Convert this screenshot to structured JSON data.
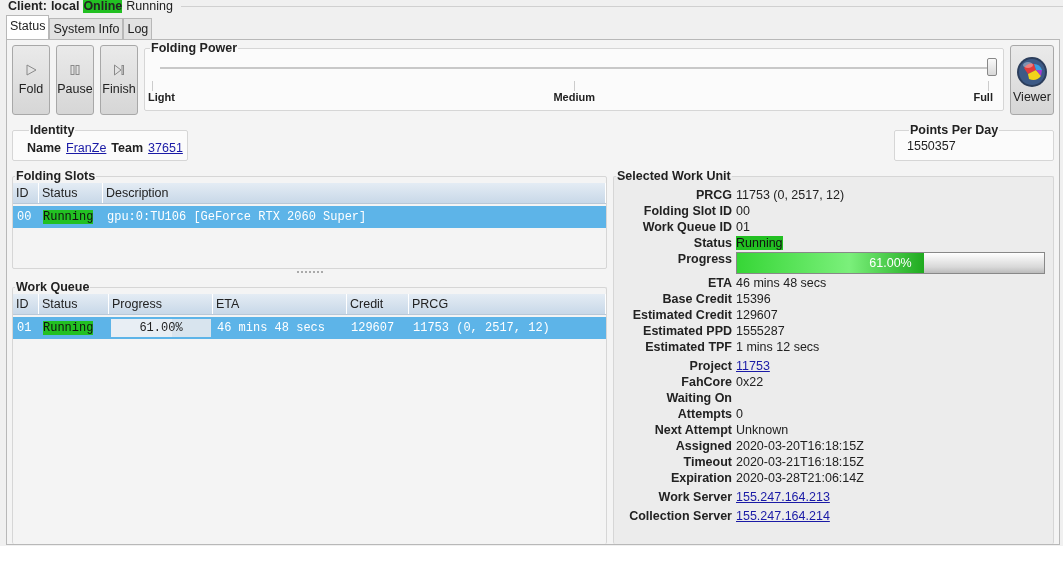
{
  "client": {
    "label": "Client:",
    "name": "local",
    "state": "Online",
    "status": "Running"
  },
  "tabs": [
    {
      "label": "Status",
      "selected": true
    },
    {
      "label": "System Info",
      "selected": false
    },
    {
      "label": "Log",
      "selected": false
    }
  ],
  "controls": [
    {
      "label": "Fold",
      "kind": "play"
    },
    {
      "label": "Pause",
      "kind": "pause"
    },
    {
      "label": "Finish",
      "kind": "finish"
    }
  ],
  "folding_power": {
    "title": "Folding Power",
    "level": 1,
    "ticks": [
      "Light",
      "Medium",
      "Full"
    ]
  },
  "viewer_button": {
    "label": "Viewer"
  },
  "identity": {
    "title": "Identity",
    "name_label": "Name",
    "name": "FranZe",
    "team_label": "Team",
    "team": "37651"
  },
  "points_per_day": {
    "title": "Points Per Day",
    "value": "1550357"
  },
  "folding_slots": {
    "title": "Folding Slots",
    "columns": [
      "ID",
      "Status",
      "Description"
    ],
    "rows": [
      {
        "id": "00",
        "status": "Running",
        "description": "gpu:0:TU106 [GeForce RTX 2060 Super]",
        "selected": true
      }
    ]
  },
  "work_queue": {
    "title": "Work Queue",
    "columns": [
      "ID",
      "Status",
      "Progress",
      "ETA",
      "Credit",
      "PRCG"
    ],
    "rows": [
      {
        "id": "01",
        "status": "Running",
        "progress": {
          "text": "61.00%",
          "level": 0.61
        },
        "eta": "46 mins 48 secs",
        "credit": "129607",
        "prcg": "11753 (0, 2517, 12)",
        "selected": true
      }
    ]
  },
  "selected_work_unit": {
    "title": "Selected Work Unit",
    "fields": [
      {
        "label": "PRCG",
        "value": "11753 (0, 2517, 12)",
        "kind": "text"
      },
      {
        "label": "Folding Slot ID",
        "value": "00",
        "kind": "text"
      },
      {
        "label": "Work Queue ID",
        "value": "01",
        "kind": "text"
      },
      {
        "label": "Status",
        "value": "Running",
        "kind": "status"
      },
      {
        "label": "Progress",
        "value": "61.00%",
        "level": 0.61,
        "kind": "progress"
      },
      {
        "label": "ETA",
        "value": "46 mins 48 secs",
        "kind": "text"
      },
      {
        "label": "Base Credit",
        "value": "15396",
        "kind": "text"
      },
      {
        "label": "Estimated Credit",
        "value": "129607",
        "kind": "text"
      },
      {
        "label": "Estimated PPD",
        "value": "1555287",
        "kind": "text"
      },
      {
        "label": "Estimated TPF",
        "value": "1 mins 12 secs",
        "kind": "text"
      },
      {
        "label": "Project",
        "value": "11753",
        "kind": "link"
      },
      {
        "label": "FahCore",
        "value": "0x22",
        "kind": "text"
      },
      {
        "label": "Waiting On",
        "kind": "text"
      },
      {
        "label": "Attempts",
        "value": "0",
        "kind": "text"
      },
      {
        "label": "Next Attempt",
        "value": "Unknown",
        "kind": "text"
      },
      {
        "label": "Assigned",
        "value": "2020-03-20T16:18:15Z",
        "kind": "text"
      },
      {
        "label": "Timeout",
        "value": "2020-03-21T16:18:15Z",
        "kind": "text"
      },
      {
        "label": "Expiration",
        "value": "2020-03-28T21:06:14Z",
        "kind": "text"
      },
      {
        "label": "Work Server",
        "value": "155.247.164.213",
        "kind": "link"
      },
      {
        "label": "Collection Server",
        "value": "155.247.164.214",
        "kind": "link"
      }
    ]
  }
}
